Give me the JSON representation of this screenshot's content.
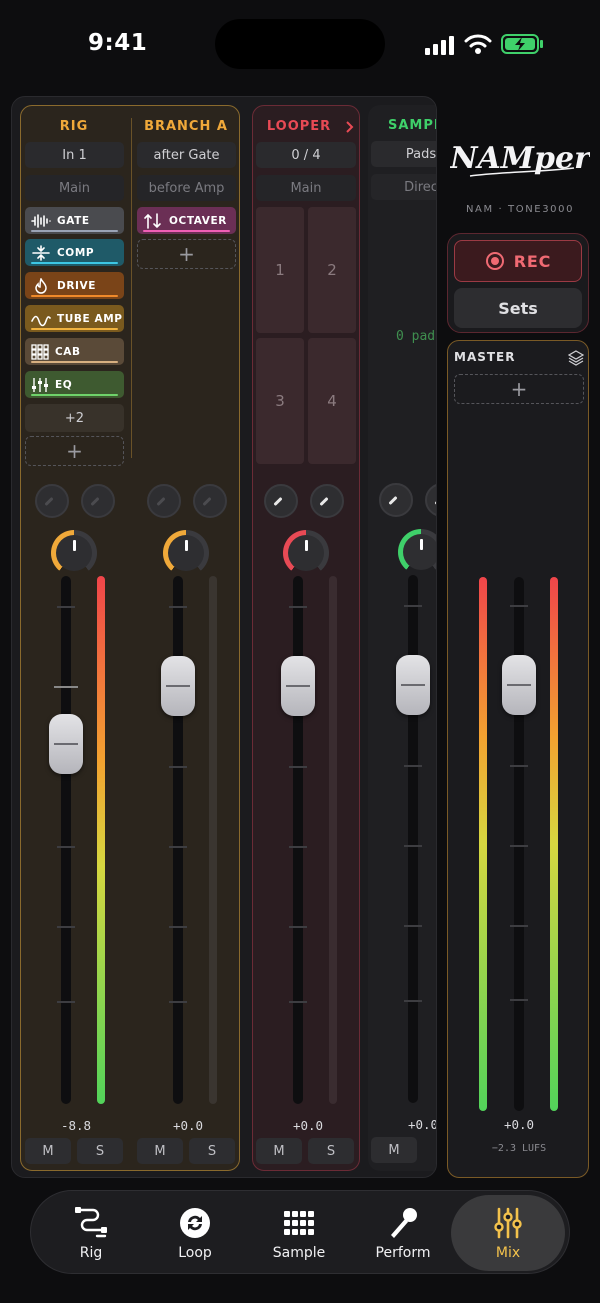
{
  "status": {
    "time": "9:41"
  },
  "mixer": {
    "rig": {
      "header": "RIG",
      "input": "In 1",
      "route": "Main",
      "effects": [
        {
          "label": "GATE",
          "icon": "waveform-icon",
          "bg": "#4a4b4f",
          "bar": "#9aa3b5"
        },
        {
          "label": "COMP",
          "icon": "compress-icon",
          "bg": "#1f5a68",
          "bar": "#3dc6e3"
        },
        {
          "label": "DRIVE",
          "icon": "flame-icon",
          "bg": "#7a4418",
          "bar": "#f08a2a"
        },
        {
          "label": "TUBE AMP",
          "icon": "wave-icon",
          "bg": "#7a5a1e",
          "bar": "#f0b340"
        },
        {
          "label": "CAB",
          "icon": "grid-icon",
          "bg": "#5a4a38",
          "bar": "#d8b080"
        },
        {
          "label": "EQ",
          "icon": "sliders-icon",
          "bg": "#3e5a30",
          "bar": "#6fd26a"
        }
      ],
      "more": "+2",
      "add": "+",
      "value": "-8.8",
      "mute": "M",
      "solo": "S"
    },
    "branch": {
      "header": "BRANCH A",
      "input": "after Gate",
      "route": "before Amp",
      "effects": [
        {
          "label": "OCTAVER",
          "icon": "arrows-updown-icon",
          "bg": "#6b2f55",
          "bar": "#ef5fb5"
        }
      ],
      "add": "+",
      "value": "+0.0",
      "mute": "M",
      "solo": "S"
    },
    "looper": {
      "header": "LOOPER",
      "counter": "0 / 4",
      "route": "Main",
      "pads": [
        "1",
        "2",
        "3",
        "4"
      ],
      "value": "+0.0",
      "mute": "M",
      "solo": "S"
    },
    "sampler": {
      "header": "SAMPL",
      "input": "Pads",
      "route": "Direc",
      "empty": "0 pad",
      "value": "+0.0",
      "mute": "M"
    }
  },
  "brand": {
    "logo": "NAMper",
    "subtitle": "NAM · TONE3000"
  },
  "controls": {
    "rec": "REC",
    "sets": "Sets"
  },
  "master": {
    "label": "MASTER",
    "add": "+",
    "value": "+0.0",
    "lufs": "−2.3 LUFS"
  },
  "tabs": [
    {
      "label": "Rig",
      "icon": "cable-icon"
    },
    {
      "label": "Loop",
      "icon": "loop-icon"
    },
    {
      "label": "Sample",
      "icon": "pads-grid-icon"
    },
    {
      "label": "Perform",
      "icon": "microphone-icon"
    },
    {
      "label": "Mix",
      "icon": "mixer-sliders-icon",
      "active": true
    }
  ],
  "colors": {
    "rig": "#f0a93a",
    "looper": "#e84a55",
    "sampler": "#3fd06a",
    "master_border": "#7a5a26"
  }
}
